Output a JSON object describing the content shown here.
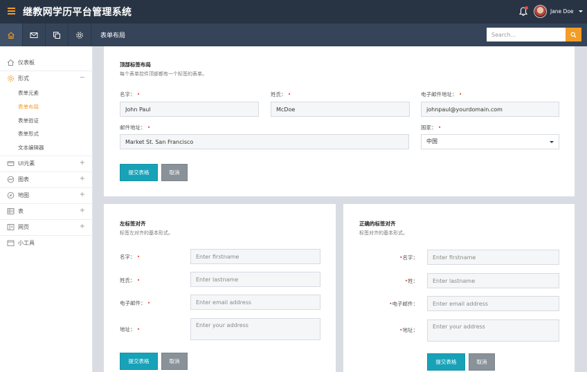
{
  "app": {
    "title": "继教网学历平台管理系统"
  },
  "header": {
    "username": "Jane Doe",
    "search_placeholder": "Search...",
    "breadcrumb": "表单布局"
  },
  "sidebar": {
    "items": [
      {
        "label": "仪表板",
        "sign": ""
      },
      {
        "label": "形式",
        "sign": "−"
      },
      {
        "label": "UI元素",
        "sign": "+"
      },
      {
        "label": "图表",
        "sign": "+"
      },
      {
        "label": "地图",
        "sign": "+"
      },
      {
        "label": "表",
        "sign": "+"
      },
      {
        "label": "网页",
        "sign": "+"
      },
      {
        "label": "小工具",
        "sign": ""
      }
    ],
    "sub_items": [
      "表单元素",
      "表单布局",
      "表单验证",
      "表单形式",
      "文本编辑器"
    ]
  },
  "top_form": {
    "title": "顶部标签布局",
    "subtitle": "每个表单控件顶部都有一个标签的表单。",
    "name_label": "名字：",
    "name_value": "John Paul",
    "surname_label": "姓氏：",
    "surname_value": "McDoe",
    "email_label": "电子邮件地址：",
    "email_value": "johnpaul@yourdomain.com",
    "address_label": "邮件地址：",
    "address_value": "Market St. San Francisco",
    "country_label": "国家：",
    "country_value": "中国",
    "submit": "提交表格",
    "cancel": "取消",
    "required_mark": "•"
  },
  "left_form": {
    "title": "左标签对齐",
    "subtitle": "标签左对齐的基本形式。",
    "name_label": "名字：",
    "name_placeholder": "Enter firstname",
    "surname_label": "姓氏：",
    "surname_placeholder": "Enter lastname",
    "email_label": "电子邮件：",
    "email_placeholder": "Enter email address",
    "address_label": "地址：",
    "address_placeholder": "Enter your address",
    "submit": "提交表格",
    "cancel": "取消",
    "required_mark": "•"
  },
  "right_form": {
    "title": "正确的标签对齐",
    "subtitle": "标签对齐的基本形式。",
    "name_label": "名字：",
    "name_placeholder": "Enter firstname",
    "surname_label": "姓：",
    "surname_placeholder": "Enter lastname",
    "email_label": "电子邮件：",
    "email_placeholder": "Enter email address",
    "address_label": "地址：",
    "address_placeholder": "Enter your address",
    "submit": "提交表格",
    "cancel": "取消",
    "required_mark": "•"
  },
  "colors": {
    "header_bg": "#283444",
    "subbar_bg": "#354459",
    "accent": "#f39c26",
    "primary_button": "#17a2b8",
    "secondary_button": "#8a9299"
  }
}
